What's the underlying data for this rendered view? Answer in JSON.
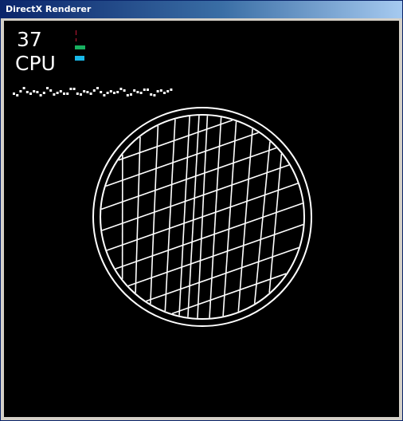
{
  "window": {
    "title": "DirectX Renderer"
  },
  "hud": {
    "fps_value": "37",
    "cpu_label": "CPU"
  },
  "colors": {
    "background": "#000000",
    "lines": "#ffffff",
    "meter_green": "#18b060",
    "meter_cyan": "#18b8e8",
    "meter_red": "#c01838"
  },
  "scene": {
    "object": "wireframe sphere with grid lines"
  }
}
